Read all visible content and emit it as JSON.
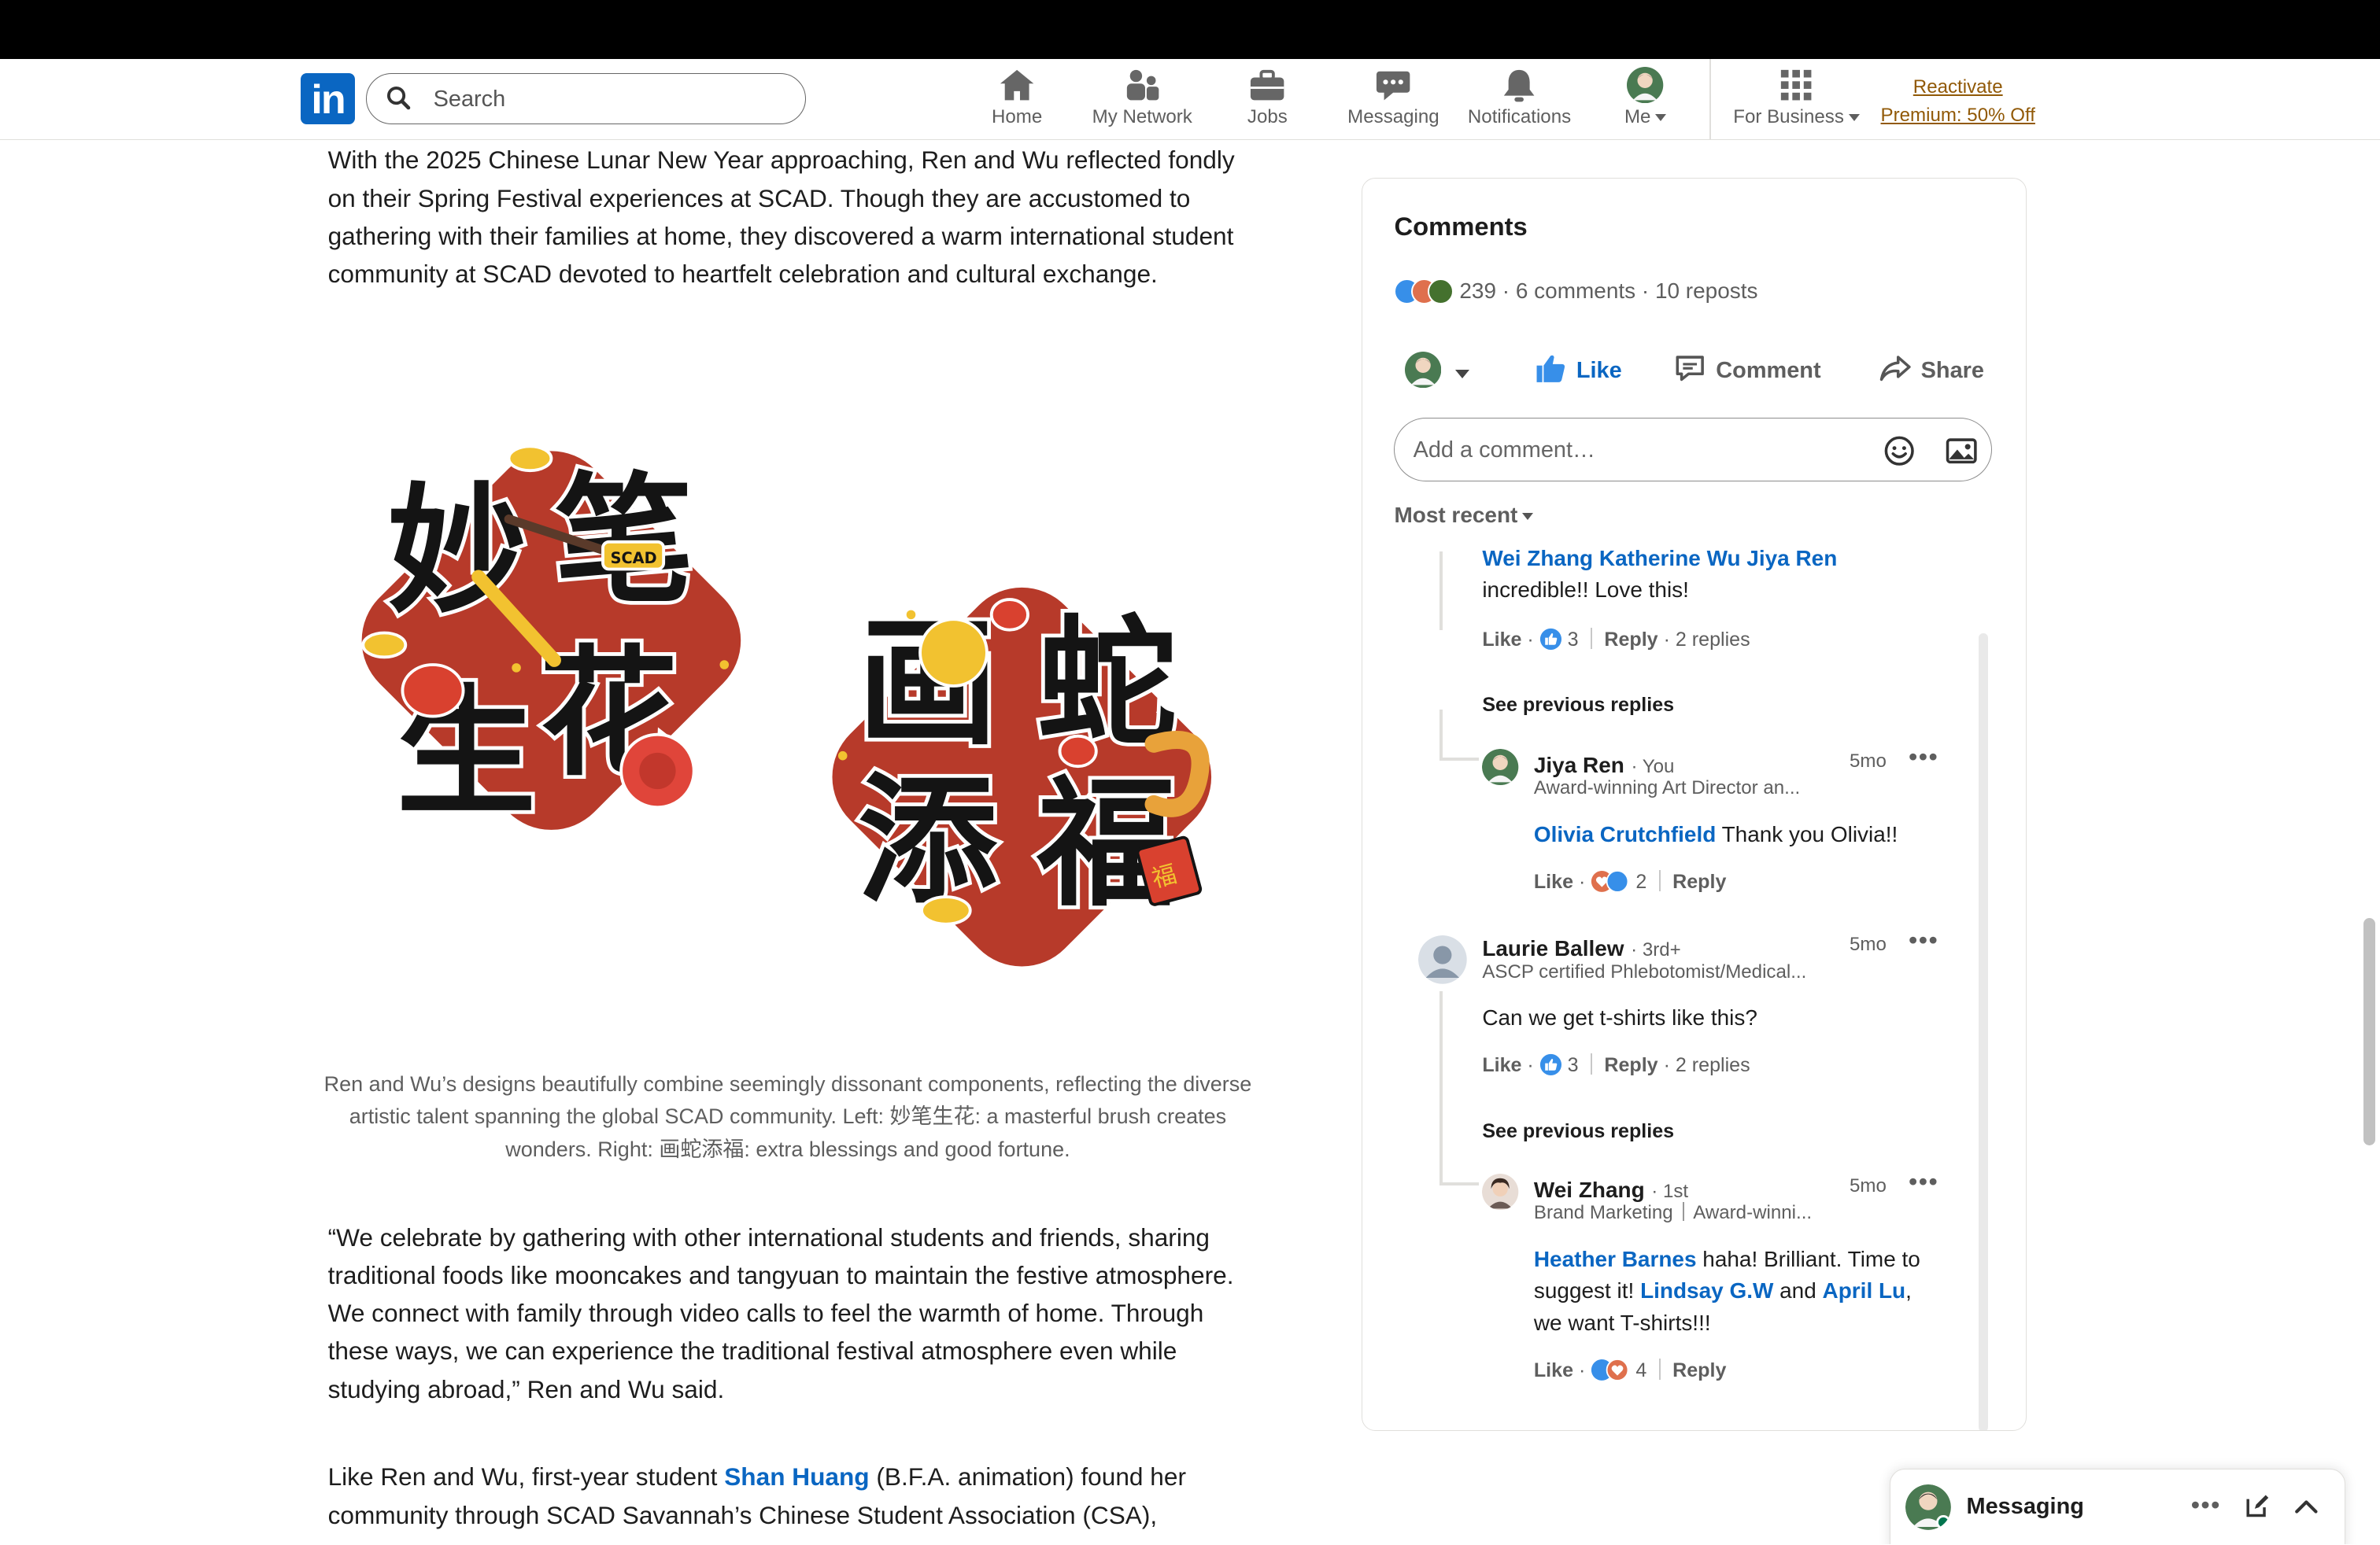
{
  "nav": {
    "search_placeholder": "Search",
    "items": [
      {
        "label": "Home",
        "icon": "home-icon"
      },
      {
        "label": "My Network",
        "icon": "network-icon"
      },
      {
        "label": "Jobs",
        "icon": "briefcase-icon"
      },
      {
        "label": "Messaging",
        "icon": "chat-icon"
      },
      {
        "label": "Notifications",
        "icon": "bell-icon"
      },
      {
        "label": "Me",
        "icon": "avatar"
      },
      {
        "label": "For Business",
        "icon": "grid-icon"
      }
    ],
    "premium_line1": "Reactivate",
    "premium_line2": "Premium: 50% Off"
  },
  "article": {
    "para1": "With the 2025 Chinese Lunar New Year approaching, Ren and Wu reflected fondly on their Spring Festival experiences at SCAD. Though they are accustomed to gathering with their families at home, they discovered a warm international student community at SCAD devoted to heartfelt celebration and cultural exchange.",
    "caption": "Ren and Wu’s designs beautifully combine seemingly dissonant components, reflecting the diverse artistic talent spanning the global SCAD community. Left: 妙笔生花: a masterful brush creates wonders. Right: 画蛇添福: extra blessings and good fortune.",
    "para2": "“We celebrate by gathering with other international students and friends, sharing traditional foods like mooncakes and tangyuan to maintain the festive atmosphere. We connect with family through video calls to feel the warmth of home. Through these ways, we can experience the traditional festival atmosphere even while studying abroad,” Ren and Wu said.",
    "para3_prefix": "Like Ren and Wu, first-year student ",
    "para3_link": "Shan Huang",
    "para3_suffix": " (B.F.A. animation) found her community through SCAD Savannah’s Chinese Student Association (CSA),",
    "left_art_chars": [
      "妙",
      "笔",
      "生",
      "花"
    ],
    "right_art_chars": [
      "画",
      "蛇",
      "添",
      "福"
    ],
    "left_art_tag": "SCAD",
    "fu_char": "福"
  },
  "comments": {
    "title": "Comments",
    "reaction_count": "239",
    "stats_text": "· 6 comments · 10 reposts",
    "actions": {
      "like": "Like",
      "comment": "Comment",
      "share": "Share"
    },
    "input_placeholder": "Add a comment…",
    "sort_label": "Most recent",
    "thread": {
      "first_mentions": "Wei Zhang Katherine Wu Jiya Ren",
      "first_text": "incredible!! Love this!",
      "first_like": "Like",
      "first_like_count": "3",
      "first_reply": "Reply",
      "first_replies": "2 replies",
      "see_prev_1": "See previous replies",
      "reply1": {
        "name": "Jiya Ren",
        "degree": "· You",
        "headline": "Award-winning Art Director an...",
        "time": "5mo",
        "mention": "Olivia Crutchfield",
        "text": " Thank you Olivia!!",
        "like": "Like",
        "count": "2",
        "reply": "Reply"
      },
      "comment2": {
        "name": "Laurie Ballew",
        "degree": "· 3rd+",
        "headline": "ASCP certified Phlebotomist/Medical...",
        "time": "5mo",
        "text": "Can we get t-shirts like this?",
        "like": "Like",
        "count": "3",
        "reply": "Reply",
        "replies": "2 replies"
      },
      "see_prev_2": "See previous replies",
      "reply2": {
        "name": "Wei Zhang",
        "degree": "· 1st",
        "headline_a": "Brand Marketing",
        "headline_b": "Award-winni...",
        "time": "5mo",
        "mention1": "Heather Barnes",
        "text1": " haha! Brilliant. Time to suggest it! ",
        "mention2": "Lindsay G.W",
        "text2": " and ",
        "mention3": "April Lu",
        "text3": ", we want T-shirts!!!",
        "like": "Like",
        "count": "4",
        "reply": "Reply"
      }
    }
  },
  "messaging": {
    "title": "Messaging"
  },
  "colors": {
    "brand": "#0a66c2",
    "art_red": "#b73a2a",
    "premium": "#915907"
  }
}
